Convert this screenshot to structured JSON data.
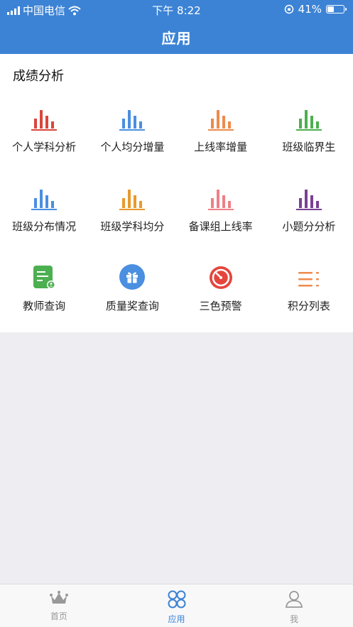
{
  "status_bar": {
    "carrier": "中国电信",
    "time": "下午 8:22",
    "battery": "41%"
  },
  "header": {
    "title": "应用"
  },
  "section": {
    "title": "成绩分析"
  },
  "apps": [
    {
      "label": "个人学科分析",
      "icon": "bar-chart-icon",
      "color": "#d9463c"
    },
    {
      "label": "个人均分增量",
      "icon": "bar-chart-icon",
      "color": "#4a8fe0"
    },
    {
      "label": "上线率增量",
      "icon": "bar-chart-icon",
      "color": "#ee8a4b"
    },
    {
      "label": "班级临界生",
      "icon": "bar-chart-icon",
      "color": "#4caf50"
    },
    {
      "label": "班级分布情况",
      "icon": "bar-chart-icon",
      "color": "#4a8fe0"
    },
    {
      "label": "班级学科均分",
      "icon": "bar-chart-icon",
      "color": "#e69a2e"
    },
    {
      "label": "备课组上线率",
      "icon": "bar-chart-icon",
      "color": "#ee7f86"
    },
    {
      "label": "小题分分析",
      "icon": "bar-chart-icon",
      "color": "#7b3f94"
    },
    {
      "label": "教师查询",
      "icon": "teacher-card-icon",
      "color": "#4caf50"
    },
    {
      "label": "质量奖查询",
      "icon": "gift-icon",
      "color": "#4a8fe0"
    },
    {
      "label": "三色预警",
      "icon": "timer-icon",
      "color": "#e4463d"
    },
    {
      "label": "积分列表",
      "icon": "list-icon",
      "color": "#ee8a4b"
    }
  ],
  "tabbar": {
    "tabs": [
      {
        "label": "首页",
        "icon": "crown-icon"
      },
      {
        "label": "应用",
        "icon": "apps-icon"
      },
      {
        "label": "我",
        "icon": "user-icon"
      }
    ],
    "active_color": "#3c83d5",
    "inactive_color": "#999999"
  }
}
